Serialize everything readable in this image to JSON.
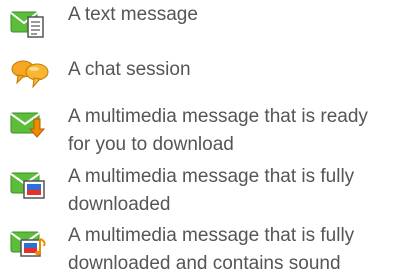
{
  "legend": {
    "items": [
      {
        "icon": "text-message-icon",
        "lines": [
          "A text message"
        ]
      },
      {
        "icon": "chat-session-icon",
        "lines": [
          "A chat session"
        ]
      },
      {
        "icon": "multimedia-download-ready-icon",
        "lines": [
          "A multimedia message that is ready",
          "for you to download"
        ]
      },
      {
        "icon": "multimedia-downloaded-icon",
        "lines": [
          "A multimedia message that is fully",
          "downloaded"
        ]
      },
      {
        "icon": "multimedia-sound-icon",
        "lines": [
          "A multimedia message that is fully",
          "downloaded and contains sound"
        ]
      }
    ]
  },
  "colors": {
    "text": "#555555",
    "envelope_green": "#5bbd3a",
    "chat_orange": "#f5a623",
    "download_arrow": "#f08a00",
    "picture_red": "#e8302a",
    "picture_blue": "#2f6fd6"
  }
}
